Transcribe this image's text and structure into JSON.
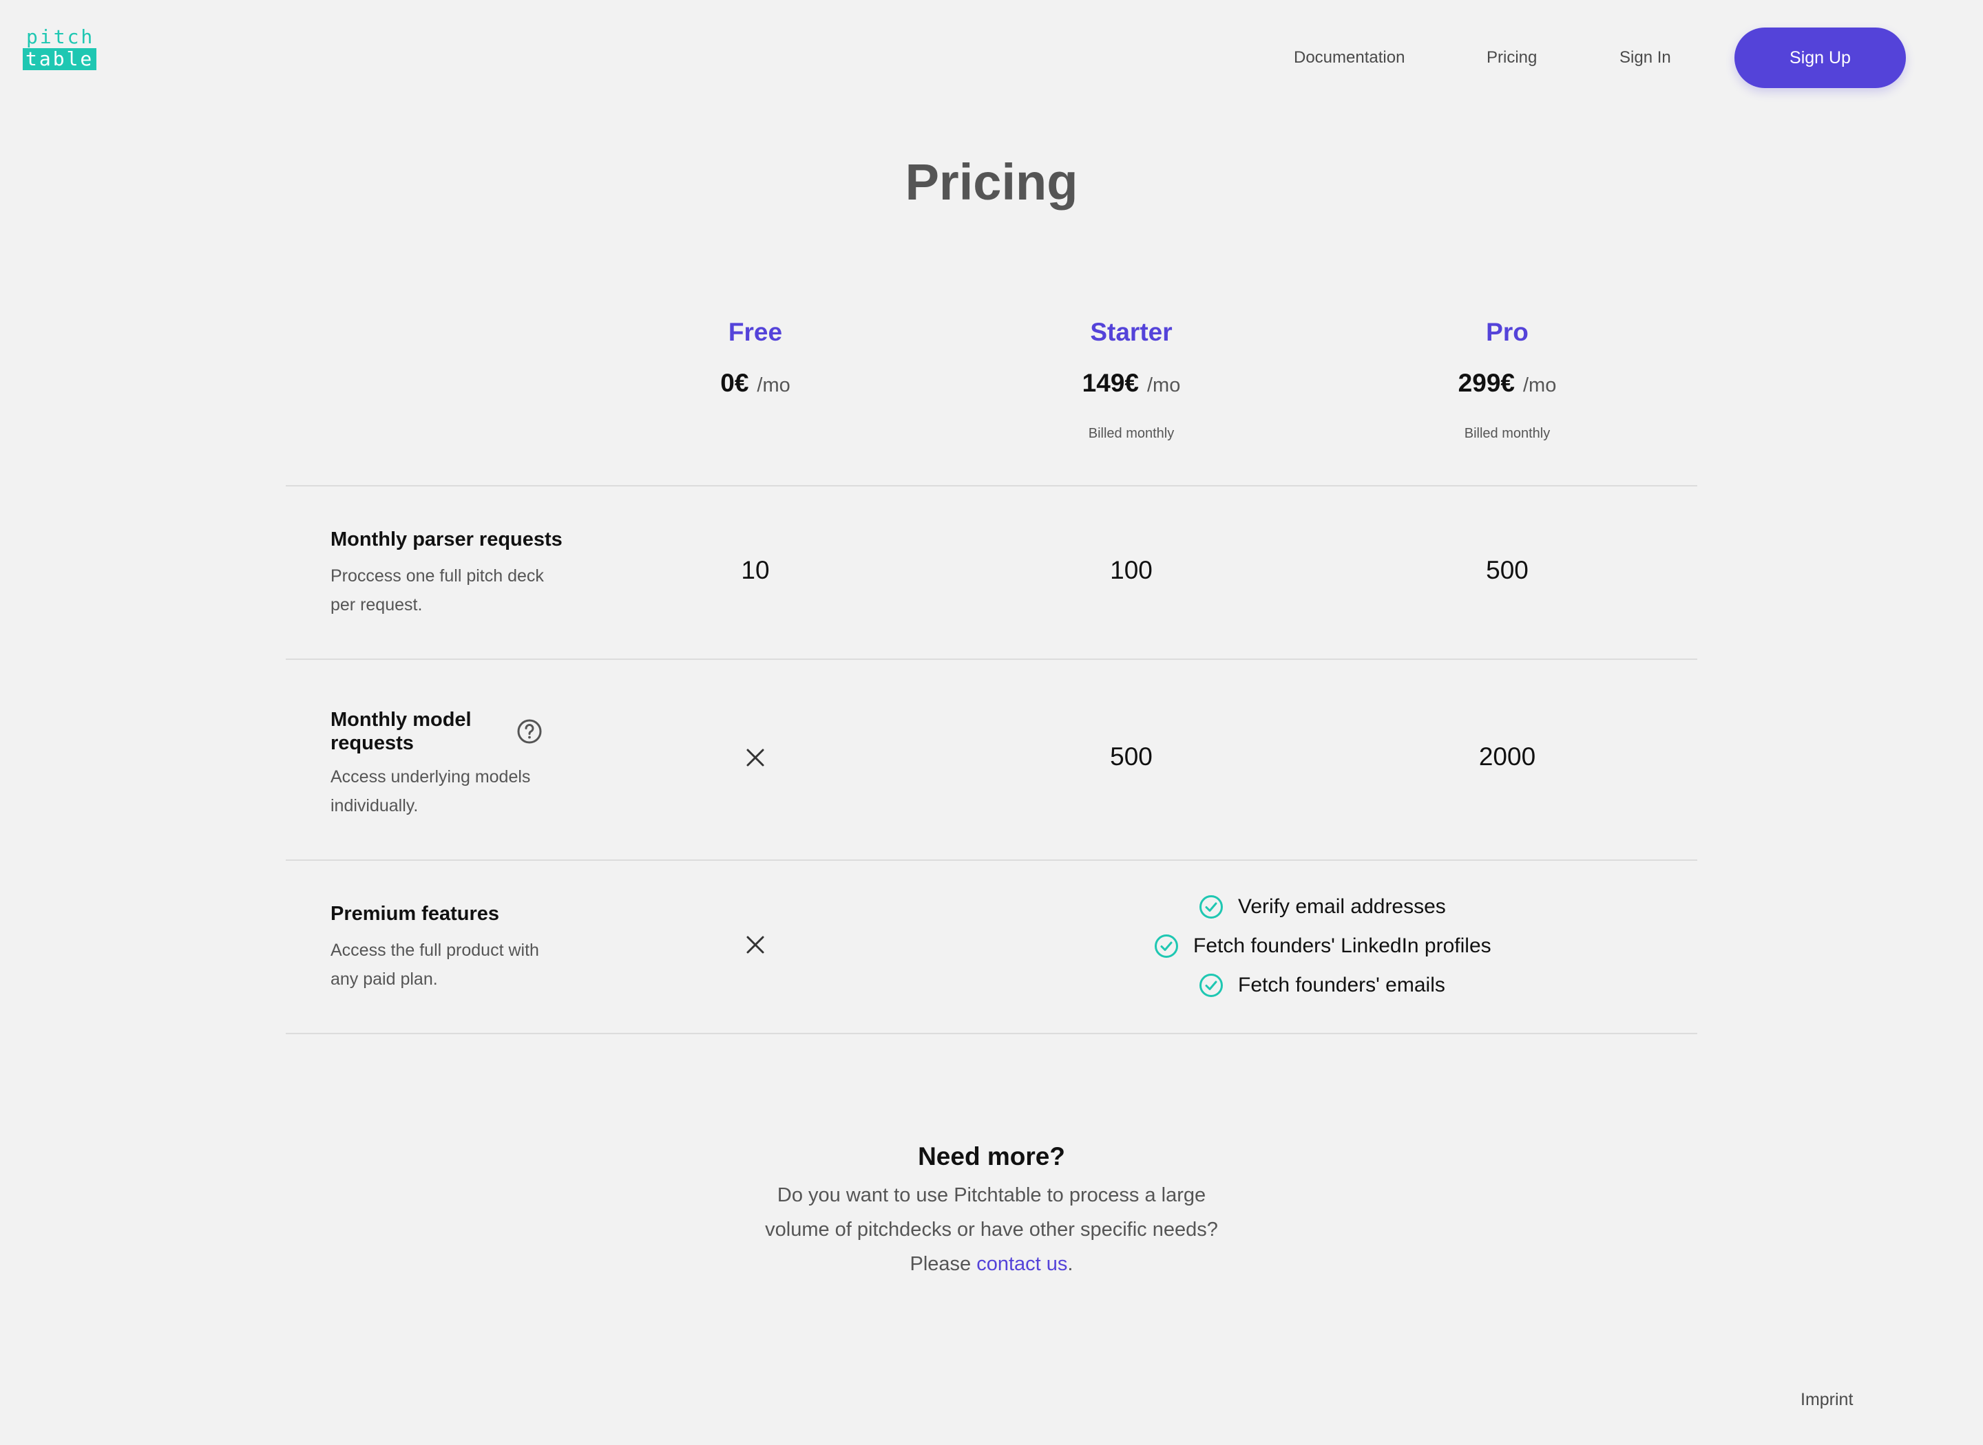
{
  "header": {
    "logo_top": "pitch",
    "logo_bottom": "table",
    "nav": {
      "documentation": "Documentation",
      "pricing": "Pricing",
      "sign_in": "Sign In",
      "sign_up": "Sign Up"
    }
  },
  "title": "Pricing",
  "plans": [
    {
      "name": "Free",
      "price": "0€",
      "period": "/mo",
      "billing": ""
    },
    {
      "name": "Starter",
      "price": "149€",
      "period": "/mo",
      "billing": "Billed monthly"
    },
    {
      "name": "Pro",
      "price": "299€",
      "period": "/mo",
      "billing": "Billed monthly"
    }
  ],
  "features": [
    {
      "title": "Monthly parser requests",
      "desc_lines": [
        "Proccess one full pitch deck",
        "per request."
      ],
      "values": [
        "10",
        "100",
        "500"
      ]
    },
    {
      "title_lines": [
        "Monthly model",
        "requests"
      ],
      "desc_lines": [
        "Access underlying models",
        "individually."
      ],
      "values": [
        "",
        "500",
        "2000"
      ],
      "free_icon": "close-icon",
      "help_icon": "help-circle-icon"
    },
    {
      "title": "Premium features",
      "desc_lines": [
        "Access the full product with",
        "any paid plan."
      ],
      "free_icon": "close-icon",
      "paid_items": [
        "Verify email addresses",
        "Fetch founders' LinkedIn profiles",
        "Fetch founders' emails"
      ],
      "item_icon": "check-circle-icon"
    }
  ],
  "need_more": {
    "title": "Need more?",
    "line1": "Do you want to use Pitchtable to process a large",
    "line2": "volume of pitchdecks or have other specific needs?",
    "line3_prefix": "Please ",
    "link": "contact us",
    "line3_suffix": "."
  },
  "footer": {
    "imprint": "Imprint"
  },
  "colors": {
    "accent": "#5443d9",
    "brand_teal": "#1fc7b2",
    "background": "#f2f2f2"
  }
}
